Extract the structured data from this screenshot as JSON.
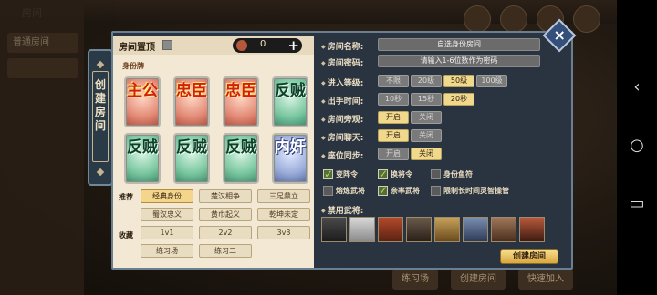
{
  "background": {
    "top_title": "房间",
    "side_rows": [
      "普通房间"
    ],
    "bottom_tabs": [
      "练习场",
      "创建房间",
      "快速加入"
    ]
  },
  "dialog": {
    "vertical_tab_label": "创建房间",
    "header": {
      "title": "房间置顶",
      "currency_value": "0",
      "plus_label": "+"
    },
    "identity_section_label": "身份牌",
    "identity_cards": [
      {
        "text": "主公",
        "type": "red"
      },
      {
        "text": "忠臣",
        "type": "red"
      },
      {
        "text": "忠臣",
        "type": "red"
      },
      {
        "text": "反贼",
        "type": "green"
      },
      {
        "text": "反贼",
        "type": "green"
      },
      {
        "text": "反贼",
        "type": "green"
      },
      {
        "text": "反贼",
        "type": "green"
      },
      {
        "text": "内奸",
        "type": "blue"
      }
    ],
    "recommend_label": "推荐",
    "favorite_label": "收藏",
    "modes": [
      [
        "经典身份",
        "楚汉相争",
        "三足鼎立"
      ],
      [
        "蜀汉忠义",
        "黄巾起义",
        "乾坤未定"
      ],
      [
        "1v1",
        "2v2",
        "3v3"
      ],
      [
        "练习场",
        "练习二"
      ]
    ],
    "selected_mode": "经典身份",
    "fields": {
      "room_name_label": "房间名称:",
      "room_name_value": "自选身份房间",
      "password_label": "房间密码:",
      "password_placeholder": "请输入1-6位数作为密码",
      "level_label": "进入等级:",
      "level_options": [
        "不限",
        "20级",
        "50级",
        "100级"
      ],
      "level_selected": "50级",
      "time_label": "出手时间:",
      "time_options": [
        "10秒",
        "15秒",
        "20秒"
      ],
      "time_selected": "20秒",
      "spectate_label": "房间旁观:",
      "spectate_options": [
        "开启",
        "关闭"
      ],
      "spectate_selected": "开启",
      "chat_label": "房间聊天:",
      "chat_options": [
        "开启",
        "关闭"
      ],
      "chat_selected": "开启",
      "seat_label": "座位同步:",
      "seat_options": [
        "开启",
        "关闭"
      ],
      "seat_selected": "关闭"
    },
    "toggles": [
      {
        "label": "变阵令",
        "checked": true
      },
      {
        "label": "换将令",
        "checked": true
      },
      {
        "label": "身份鱼符",
        "checked": false
      },
      {
        "label": "熔炼武将",
        "checked": false
      },
      {
        "label": "亲率武将",
        "checked": true
      },
      {
        "label": "限制长时间灵智操管",
        "checked": false
      }
    ],
    "banned_label": "禁用武将:",
    "banned_heroes_count": 8,
    "create_button": "创建房间"
  },
  "colors": {
    "red_card": "#d11f10",
    "green_card": "#0d3f29",
    "selected_option": "#f0d98d",
    "panel_bg": "#2a3440"
  }
}
